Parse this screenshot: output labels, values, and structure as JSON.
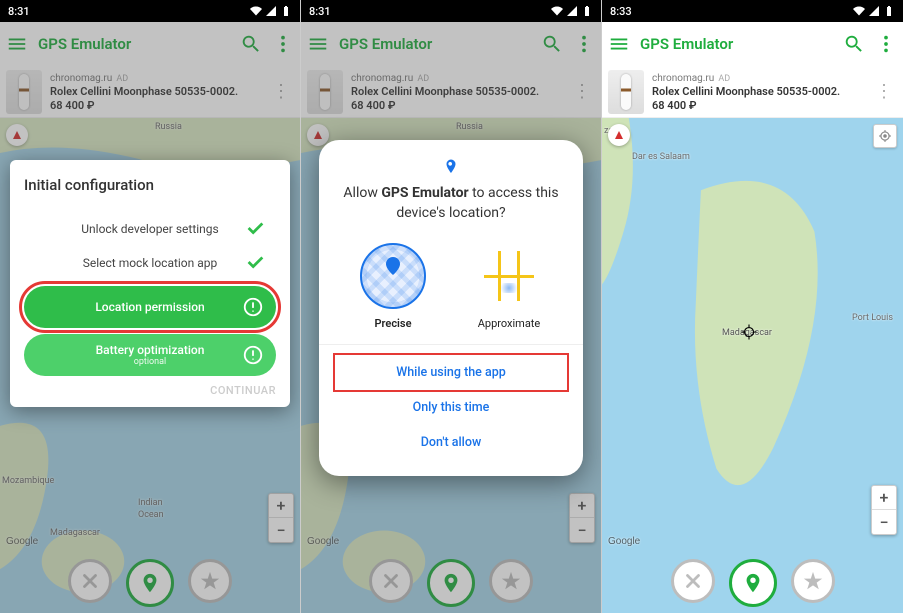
{
  "screens": [
    {
      "time": "8:31"
    },
    {
      "time": "8:31"
    },
    {
      "time": "8:33"
    }
  ],
  "app_title": "GPS Emulator",
  "ad": {
    "domain": "chronomag.ru",
    "tag": "AD",
    "title": "Rolex Cellini Moonphase 50535-0002.",
    "price": "68 400 ₽"
  },
  "config": {
    "heading": "Initial configuration",
    "row1": "Unlock developer settings",
    "row2": "Select mock location app",
    "pill1": "Location permission",
    "pill2": "Battery optimization",
    "pill2_sub": "optional",
    "continue": "CONTINUAR"
  },
  "perm": {
    "prefix": "Allow ",
    "app": "GPS Emulator",
    "suffix": " to access this device's location?",
    "precise": "Precise",
    "approx": "Approximate",
    "opt1": "While using the app",
    "opt2": "Only this time",
    "opt3": "Don't allow"
  },
  "map": {
    "russia": "Russia",
    "madagascar": "Madagascar",
    "mozambique": "Mozambique",
    "indian": "Indian",
    "ocean": "Ocean",
    "tanzania": "zania",
    "dar": "Dar es Salaam",
    "portlouis": "Port Louis",
    "google": "Google"
  },
  "zoom": {
    "in": "+",
    "out": "−"
  }
}
